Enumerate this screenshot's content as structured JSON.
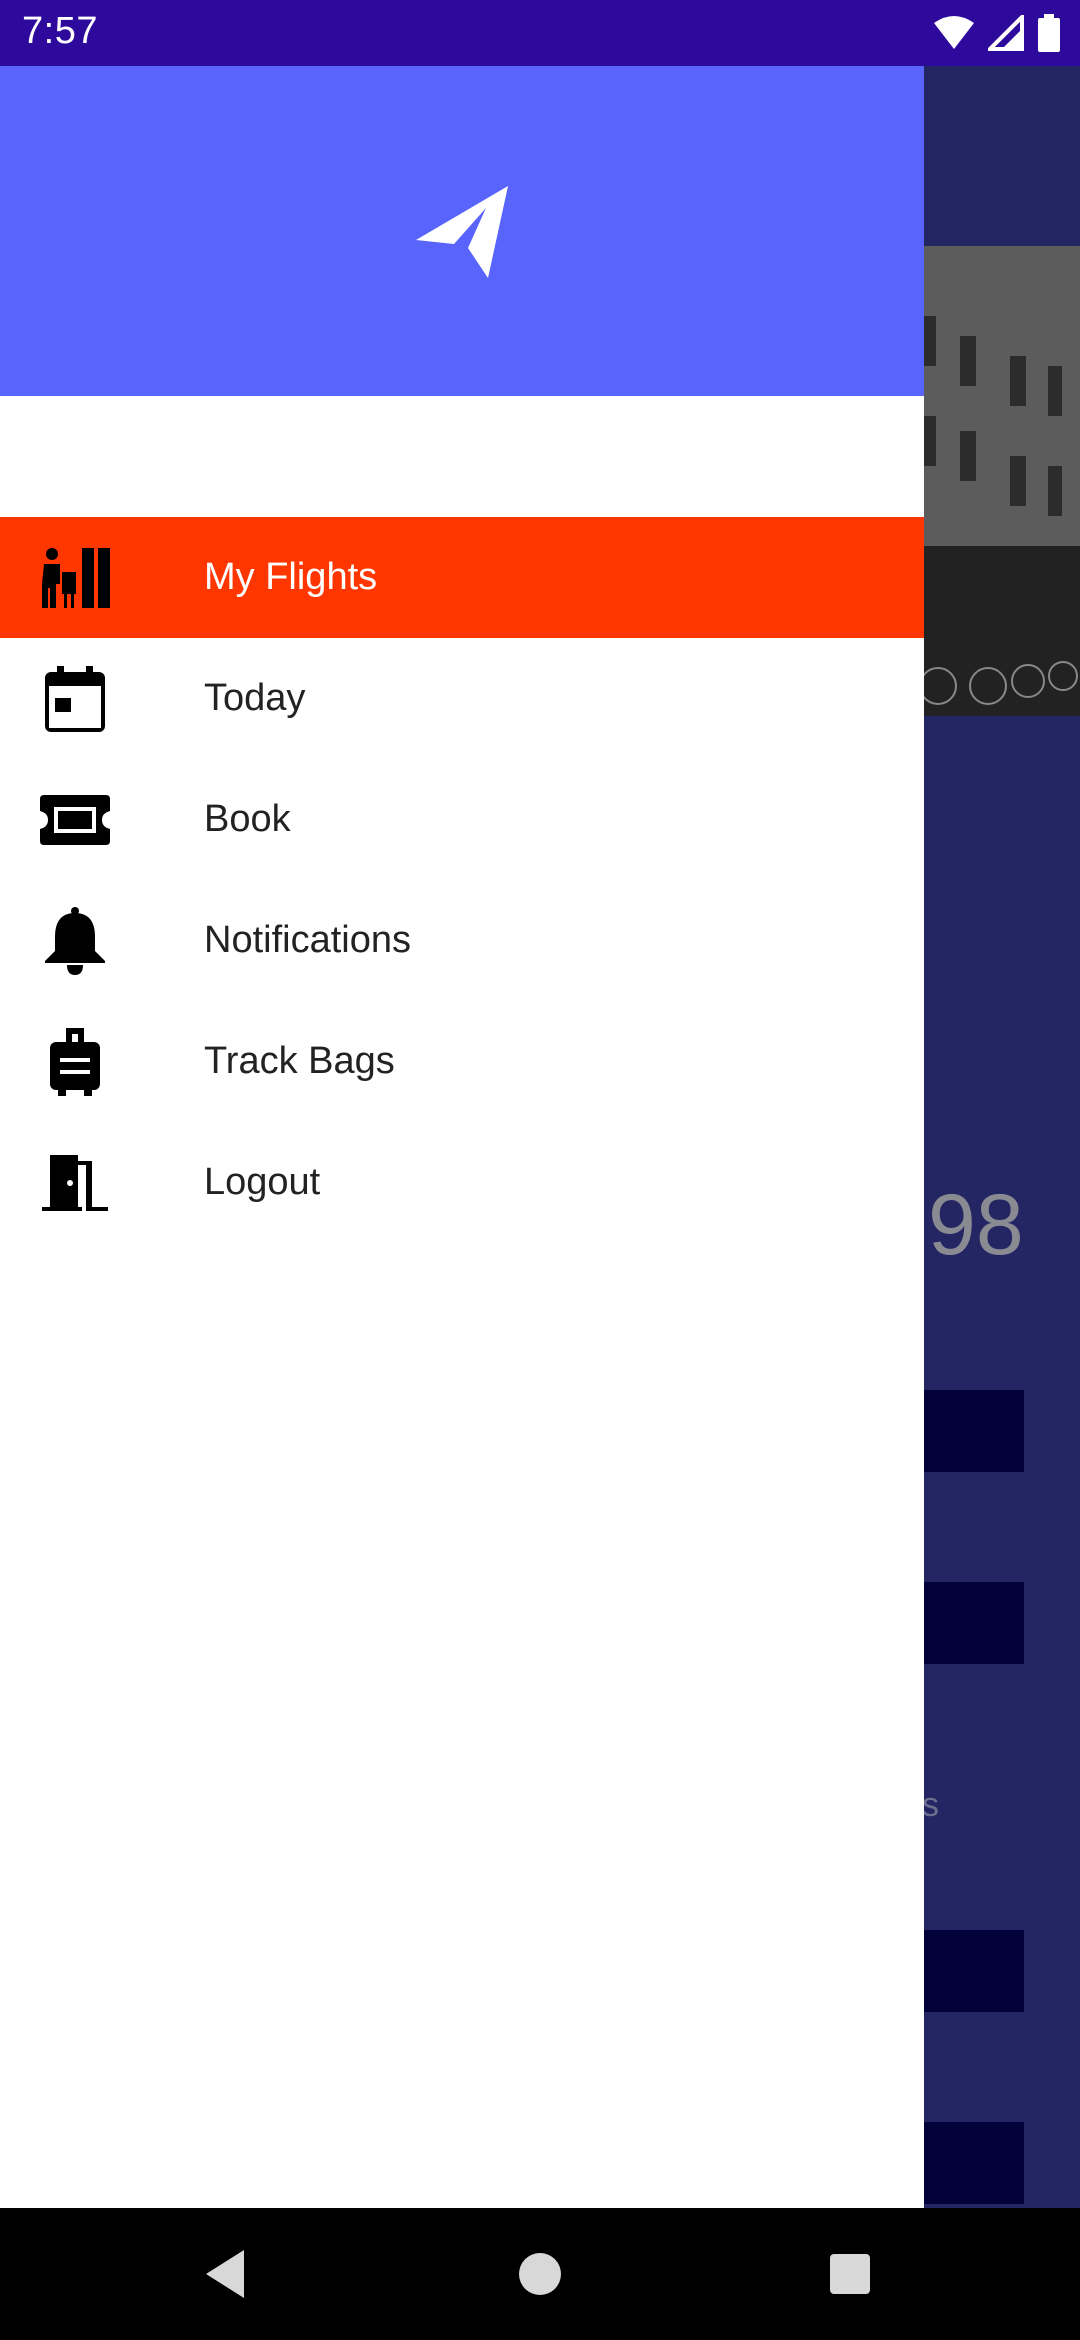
{
  "status_bar": {
    "time": "7:57",
    "icons": [
      "wifi-icon",
      "signal-icon",
      "battery-icon"
    ]
  },
  "background": {
    "number_fragment": "98",
    "faint_text": "s"
  },
  "drawer": {
    "header_icon": "paper-plane-icon",
    "header_color": "#5864fb",
    "items": [
      {
        "label": "My Flights",
        "icon": "traveler-luggage-icon",
        "active": true
      },
      {
        "label": "Today",
        "icon": "calendar-icon",
        "active": false
      },
      {
        "label": "Book",
        "icon": "ticket-icon",
        "active": false
      },
      {
        "label": "Notifications",
        "icon": "bell-icon",
        "active": false
      },
      {
        "label": "Track Bags",
        "icon": "suitcase-icon",
        "active": false
      },
      {
        "label": "Logout",
        "icon": "door-exit-icon",
        "active": false
      }
    ],
    "active_color": "#ff3600"
  },
  "nav_bar": {
    "buttons": [
      "back-icon",
      "home-icon",
      "recents-icon"
    ]
  }
}
